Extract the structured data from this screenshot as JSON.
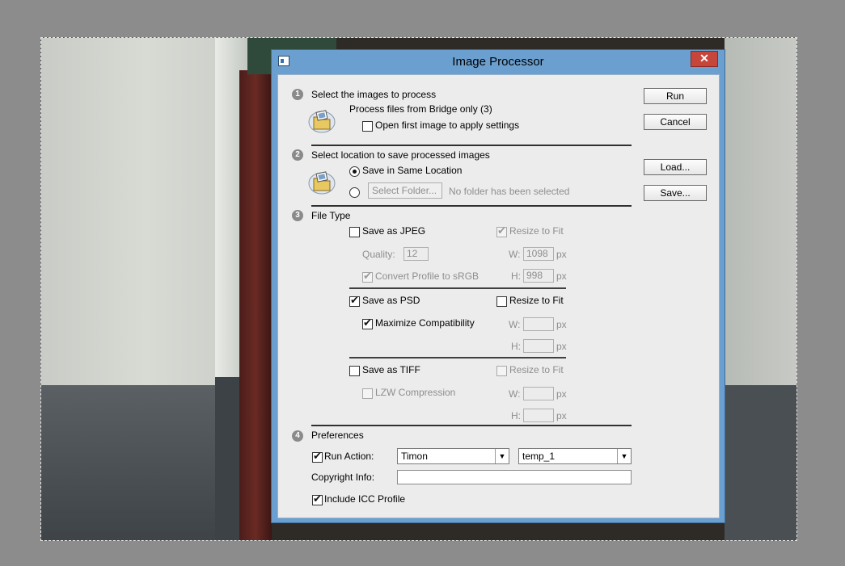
{
  "dialog": {
    "title": "Image Processor",
    "close_glyph": "✕"
  },
  "buttons": {
    "run": "Run",
    "cancel": "Cancel",
    "load": "Load...",
    "save": "Save..."
  },
  "section1": {
    "number": "1",
    "title": "Select the images to process",
    "source_text": "Process files from Bridge only (3)",
    "open_first_label": "Open first image to apply settings",
    "open_first_checked": false
  },
  "section2": {
    "number": "2",
    "title": "Select location to save processed images",
    "same_location_label": "Save in Same Location",
    "select_folder_button": "Select Folder...",
    "no_folder_text": "No folder has been selected"
  },
  "section3": {
    "number": "3",
    "title": "File Type",
    "jpeg": {
      "label": "Save as JPEG",
      "checked": false,
      "resize_label": "Resize to Fit",
      "quality_label": "Quality:",
      "quality_value": "12",
      "w_label": "W:",
      "w_value": "1098",
      "h_label": "H:",
      "h_value": "998",
      "unit": "px",
      "convert_label": "Convert Profile to sRGB"
    },
    "psd": {
      "label": "Save as PSD",
      "checked": true,
      "resize_label": "Resize to Fit",
      "maximize_label": "Maximize Compatibility",
      "w_label": "W:",
      "h_label": "H:",
      "unit": "px"
    },
    "tiff": {
      "label": "Save as TIFF",
      "checked": false,
      "resize_label": "Resize to Fit",
      "lzw_label": "LZW Compression",
      "w_label": "W:",
      "h_label": "H:",
      "unit": "px"
    }
  },
  "section4": {
    "number": "4",
    "title": "Preferences",
    "run_action_label": "Run Action:",
    "run_action_checked": true,
    "action_set": "Timon",
    "action_name": "temp_1",
    "copyright_label": "Copyright Info:",
    "copyright_value": "",
    "icc_label": "Include ICC Profile",
    "icc_checked": true
  },
  "icons": {
    "folder": "folder-image-icon",
    "dropdown": "chevron-down-icon",
    "checkmark": "✔"
  },
  "colors": {
    "titlebar": "#6b9fcf",
    "close": "#c7463b",
    "dialog_bg": "#ececec"
  }
}
